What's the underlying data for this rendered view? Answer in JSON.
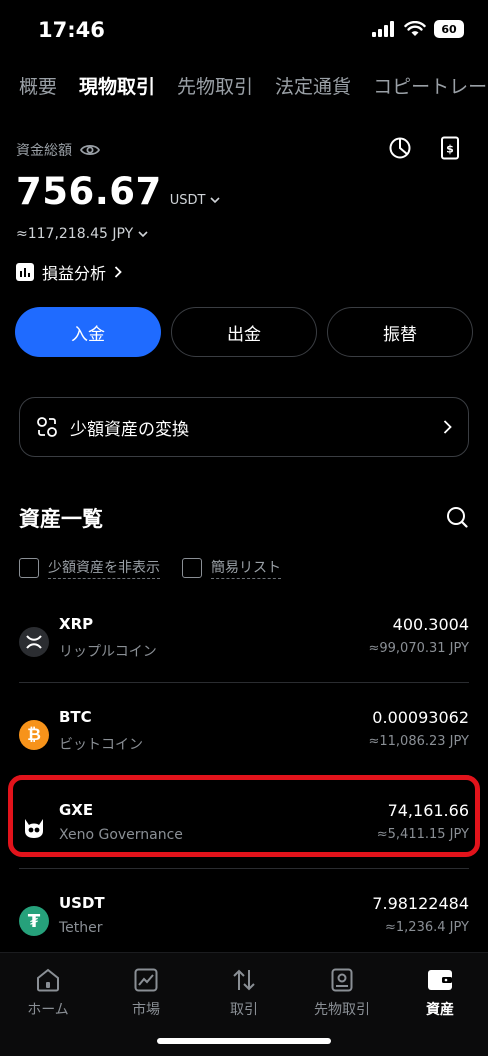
{
  "status": {
    "time": "17:46",
    "battery": "60"
  },
  "tabs": [
    {
      "label": "概要"
    },
    {
      "label": "現物取引"
    },
    {
      "label": "先物取引"
    },
    {
      "label": "法定通貨"
    },
    {
      "label": "コピートレー"
    }
  ],
  "summary": {
    "label": "資金総額",
    "balance": "756.67",
    "unit": "USDT",
    "jpy": "≈117,218.45 JPY",
    "pnl_label": "損益分析"
  },
  "actions": {
    "deposit": "入金",
    "withdraw": "出金",
    "transfer": "振替"
  },
  "convert": {
    "label": "少額資産の変換"
  },
  "list": {
    "title": "資産一覧",
    "filters": [
      {
        "label": "少額資産を非表示"
      },
      {
        "label": "簡易リスト"
      }
    ],
    "assets": [
      {
        "symbol": "XRP",
        "name": "リップルコイン",
        "amount": "400.3004",
        "jpy": "≈99,070.31 JPY"
      },
      {
        "symbol": "BTC",
        "name": "ビットコイン",
        "amount": "0.00093062",
        "jpy": "≈11,086.23 JPY"
      },
      {
        "symbol": "GXE",
        "name": "Xeno Governance",
        "amount": "74,161.66",
        "jpy": "≈5,411.15 JPY"
      },
      {
        "symbol": "USDT",
        "name": "Tether",
        "amount": "7.98122484",
        "jpy": "≈1,236.4 JPY"
      }
    ]
  },
  "nav": [
    {
      "label": "ホーム"
    },
    {
      "label": "市場"
    },
    {
      "label": "取引"
    },
    {
      "label": "先物取引"
    },
    {
      "label": "資産"
    }
  ],
  "colors": {
    "accent": "#1f6bff",
    "highlight": "#e2131b",
    "btc": "#f7931a",
    "usdt": "#26a17b"
  }
}
